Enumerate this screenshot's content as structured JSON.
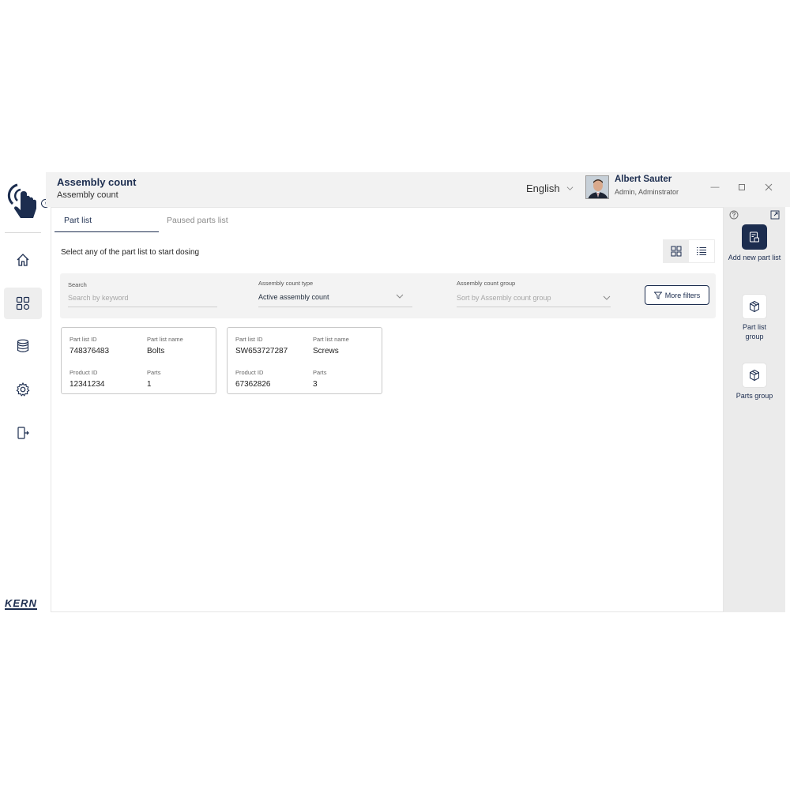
{
  "brand": {
    "name": "KERN"
  },
  "header": {
    "title": "Assembly count",
    "subtitle": "Assembly count",
    "language": "English",
    "user": {
      "name": "Albert Sauter",
      "role": "Admin, Adminstrator"
    }
  },
  "nav": {
    "items": [
      {
        "icon": "home-icon"
      },
      {
        "icon": "grid-icon",
        "active": true
      },
      {
        "icon": "database-icon"
      },
      {
        "icon": "gear-icon"
      },
      {
        "icon": "logout-icon"
      }
    ]
  },
  "tabs": [
    {
      "label": "Part list",
      "active": true
    },
    {
      "label": "Paused parts list",
      "active": false
    }
  ],
  "main": {
    "prompt": "Select any of the part list to start dosing"
  },
  "filters": {
    "search": {
      "label": "Search",
      "placeholder": "Search by keyword"
    },
    "type": {
      "label": "Assembly count type",
      "value": "Active assembly count"
    },
    "group": {
      "label": "Assembly count group",
      "placeholder": "Sort by Assembly count group"
    },
    "more_label": "More filters"
  },
  "cards": [
    {
      "id_label": "Part list ID",
      "id": "748376483",
      "name_label": "Part list name",
      "name": "Bolts",
      "product_label": "Product ID",
      "product": "12341234",
      "parts_label": "Parts",
      "parts": "1"
    },
    {
      "id_label": "Part list ID",
      "id": "SW653727287",
      "name_label": "Part list name",
      "name": "Screws",
      "product_label": "Product ID",
      "product": "67362826",
      "parts_label": "Parts",
      "parts": "3"
    }
  ],
  "actions": [
    {
      "label": "Add new part list",
      "icon": "add-list-icon"
    },
    {
      "label": "Part list group",
      "icon": "box-icon"
    },
    {
      "label": "Parts group",
      "icon": "box-icon"
    }
  ],
  "colors": {
    "primary": "#1c2d4f",
    "header_bg": "#f2f2f2",
    "panel_bg": "#ebebeb"
  }
}
